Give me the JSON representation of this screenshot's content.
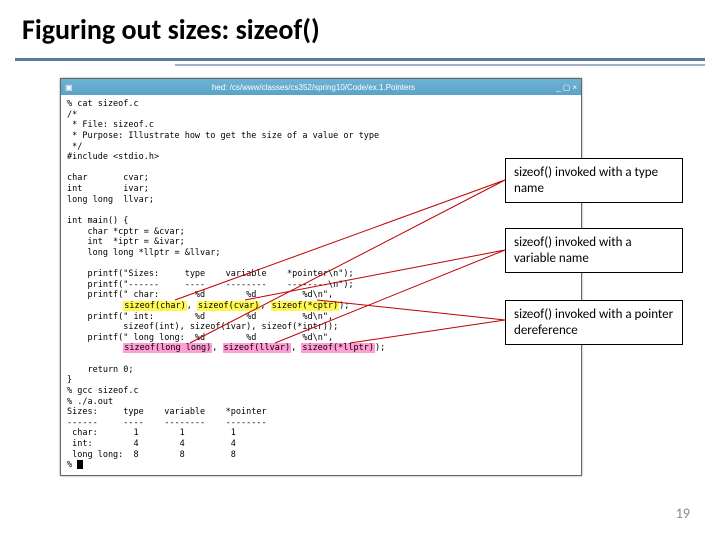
{
  "title": "Figuring out sizes: sizeof()",
  "terminal": {
    "titlebar": "hed: /cs/www/classes/cs352/spring10/Code/ex.1.Pointers",
    "lines": {
      "l0": "% cat sizeof.c",
      "l1": "/*",
      "l2": " * File: sizeof.c",
      "l3": " * Purpose: Illustrate how to get the size of a value or type",
      "l4": " */",
      "l5": "#include <stdio.h>",
      "l6": "",
      "l7": "char       cvar;",
      "l8": "int        ivar;",
      "l9": "long long  llvar;",
      "l10": "",
      "l11": "int main() {",
      "l12": "    char *cptr = &cvar;",
      "l13": "    int  *iptr = &ivar;",
      "l14": "    long long *llptr = &llvar;",
      "l15": "",
      "l16": "    printf(\"Sizes:     type    variable    *pointer\\n\");",
      "l17": "    printf(\"------     ----    --------    --------\\n\");",
      "l18_a": "    printf(\" char:       %d        %d         %d\\n\",",
      "l18_h1": "sizeof(char)",
      "l18_b": ", ",
      "l18_h2": "sizeof(cvar)",
      "l18_c": ", ",
      "l18_h3": "sizeof(*cptr)",
      "l18_d": ");",
      "l19_a": "    printf(\" int:        %d        %d         %d\\n\",",
      "l19_b": "           sizeof(int), sizeof(ivar), sizeof(*iptr));",
      "l20_a": "    printf(\" long long:  %d        %d         %d\\n\",",
      "l20_h1": "sizeof(long long)",
      "l20_b": ", ",
      "l20_h2": "sizeof(llvar)",
      "l20_c": ", ",
      "l20_h3": "sizeof(*llptr)",
      "l20_d": ");",
      "l21": "",
      "l22": "    return 0;",
      "l23": "}",
      "l24": "% gcc sizeof.c",
      "l25": "% ./a.out",
      "l26": "Sizes:     type    variable    *pointer",
      "l27": "------     ----    --------    --------",
      "l28": " char:       1        1         1",
      "l29": " int:        4        4         4",
      "l30": " long long:  8        8         8",
      "l31": "% "
    }
  },
  "callouts": {
    "c1": "sizeof() invoked with a type name",
    "c2": "sizeof() invoked with a variable name",
    "c3": "sizeof() invoked with a pointer dereference"
  },
  "page_number": "19"
}
